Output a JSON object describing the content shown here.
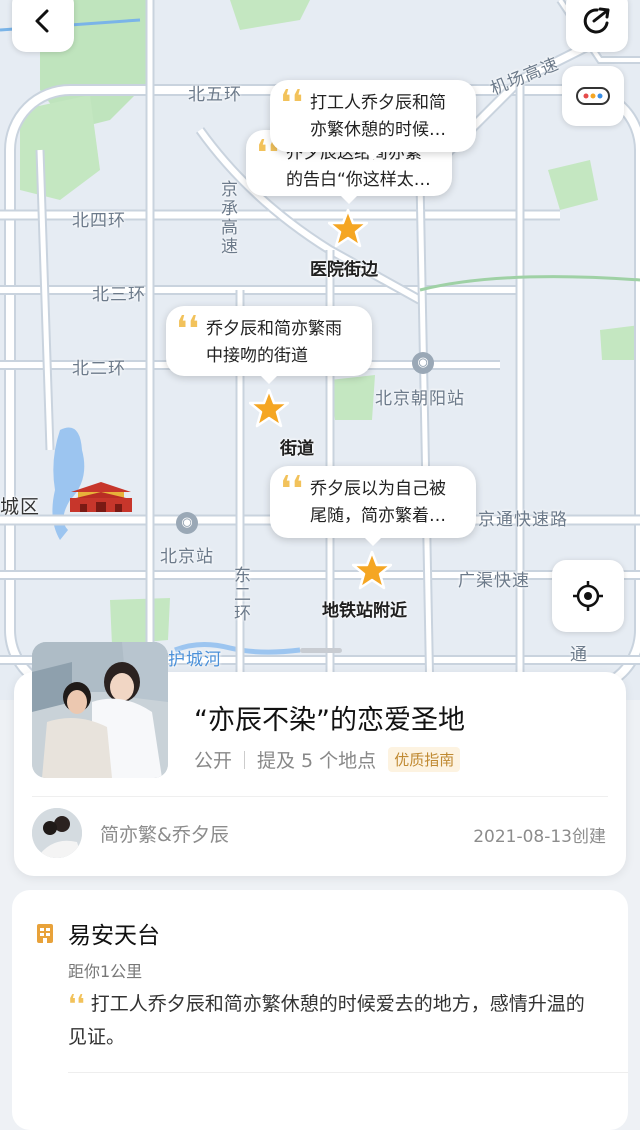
{
  "map": {
    "road_labels": [
      {
        "id": "north5",
        "text": "北五环"
      },
      {
        "id": "north4",
        "text": "北四环"
      },
      {
        "id": "north3",
        "text": "北三环"
      },
      {
        "id": "north2",
        "text": "北二环"
      },
      {
        "id": "airport",
        "text": "机场高速"
      },
      {
        "id": "jingcheng",
        "text": "京承高速"
      },
      {
        "id": "district",
        "text": "城区"
      },
      {
        "id": "beijing_station",
        "text": "北京站"
      },
      {
        "id": "chaoyang_station",
        "text": "北京朝阳站"
      },
      {
        "id": "jingtong",
        "text": "京通快速路"
      },
      {
        "id": "guangqu",
        "text": "广渠快速"
      },
      {
        "id": "east2",
        "text": "东二环"
      },
      {
        "id": "moat",
        "text": "护城河"
      },
      {
        "id": "tong",
        "text": "通"
      }
    ],
    "pois": [
      {
        "id": "hospital",
        "bubble": "乔夕辰送给简亦繁的告白“你这样太…",
        "name": "医院街边"
      },
      {
        "id": "yian",
        "bubble": "打工人乔夕辰和简亦繁休憩的时候…",
        "name": ""
      },
      {
        "id": "street",
        "bubble": "乔夕辰和简亦繁雨中接吻的街道",
        "name": "街道"
      },
      {
        "id": "subway",
        "bubble": "乔夕辰以为自己被尾随，简亦繁着…",
        "name": "地铁站附近"
      }
    ],
    "colors": {
      "star": "#f5a623",
      "water": "#9cc5f0",
      "green": "#b6e2b4",
      "road": "#ffffff",
      "road_border": "#c9d3de"
    }
  },
  "buttons": {
    "back_icon": "chevron-left-icon",
    "share_icon": "share-icon",
    "more_icon": "more-dots-icon",
    "locate_icon": "locate-icon"
  },
  "guide": {
    "title": "“亦辰不染”的恋爱圣地",
    "visibility": "公开",
    "mentions": "提及 5 个地点",
    "badge": "优质指南",
    "author": "简亦繁&乔夕辰",
    "created": "2021-08-13创建"
  },
  "place": {
    "name": "易安天台",
    "distance": "距你1公里",
    "description": "打工人乔夕辰和简亦繁休憩的时候爱去的地方，感情升温的见证。",
    "quote": "❛❛"
  }
}
